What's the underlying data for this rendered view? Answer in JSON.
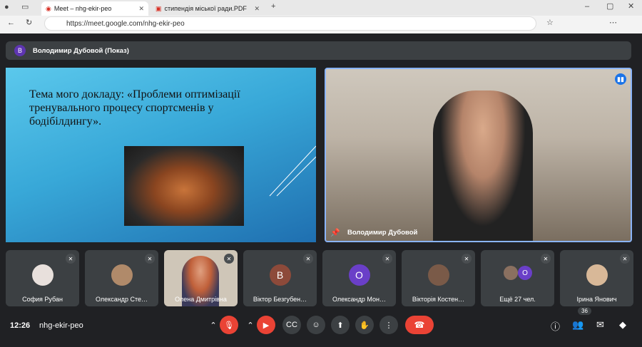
{
  "browser": {
    "tabs": [
      {
        "label": "Meet – nhg-ekir-peo"
      },
      {
        "label": "стипендія міської ради.PDF"
      }
    ],
    "url": "https://meet.google.com/nhg-ekir-peo"
  },
  "presenter": {
    "initial": "В",
    "name": "Володимир Дубовой (Показ)"
  },
  "slide": {
    "title": "Тема мого докладу: «Проблеми оптимізації тренувального процесу спортсменів у бодібілдингу»."
  },
  "main_video": {
    "name": "Володимир Дубовой"
  },
  "participants": [
    {
      "name": "София Рубан",
      "initial": ""
    },
    {
      "name": "Олександр Сте…",
      "initial": ""
    },
    {
      "name": "Олена Дмитрівна",
      "initial": ""
    },
    {
      "name": "Віктор Безгубен…",
      "initial": "В"
    },
    {
      "name": "Олександр Мон…",
      "initial": "О"
    },
    {
      "name": "Вікторія Костен…",
      "initial": ""
    },
    {
      "name": "Ещё 27 чел.",
      "initial": "О"
    },
    {
      "name": "Ірина Янович",
      "initial": ""
    }
  ],
  "bottom": {
    "time": "12:26",
    "code": "nhg-ekir-peo",
    "participant_count": "36"
  }
}
